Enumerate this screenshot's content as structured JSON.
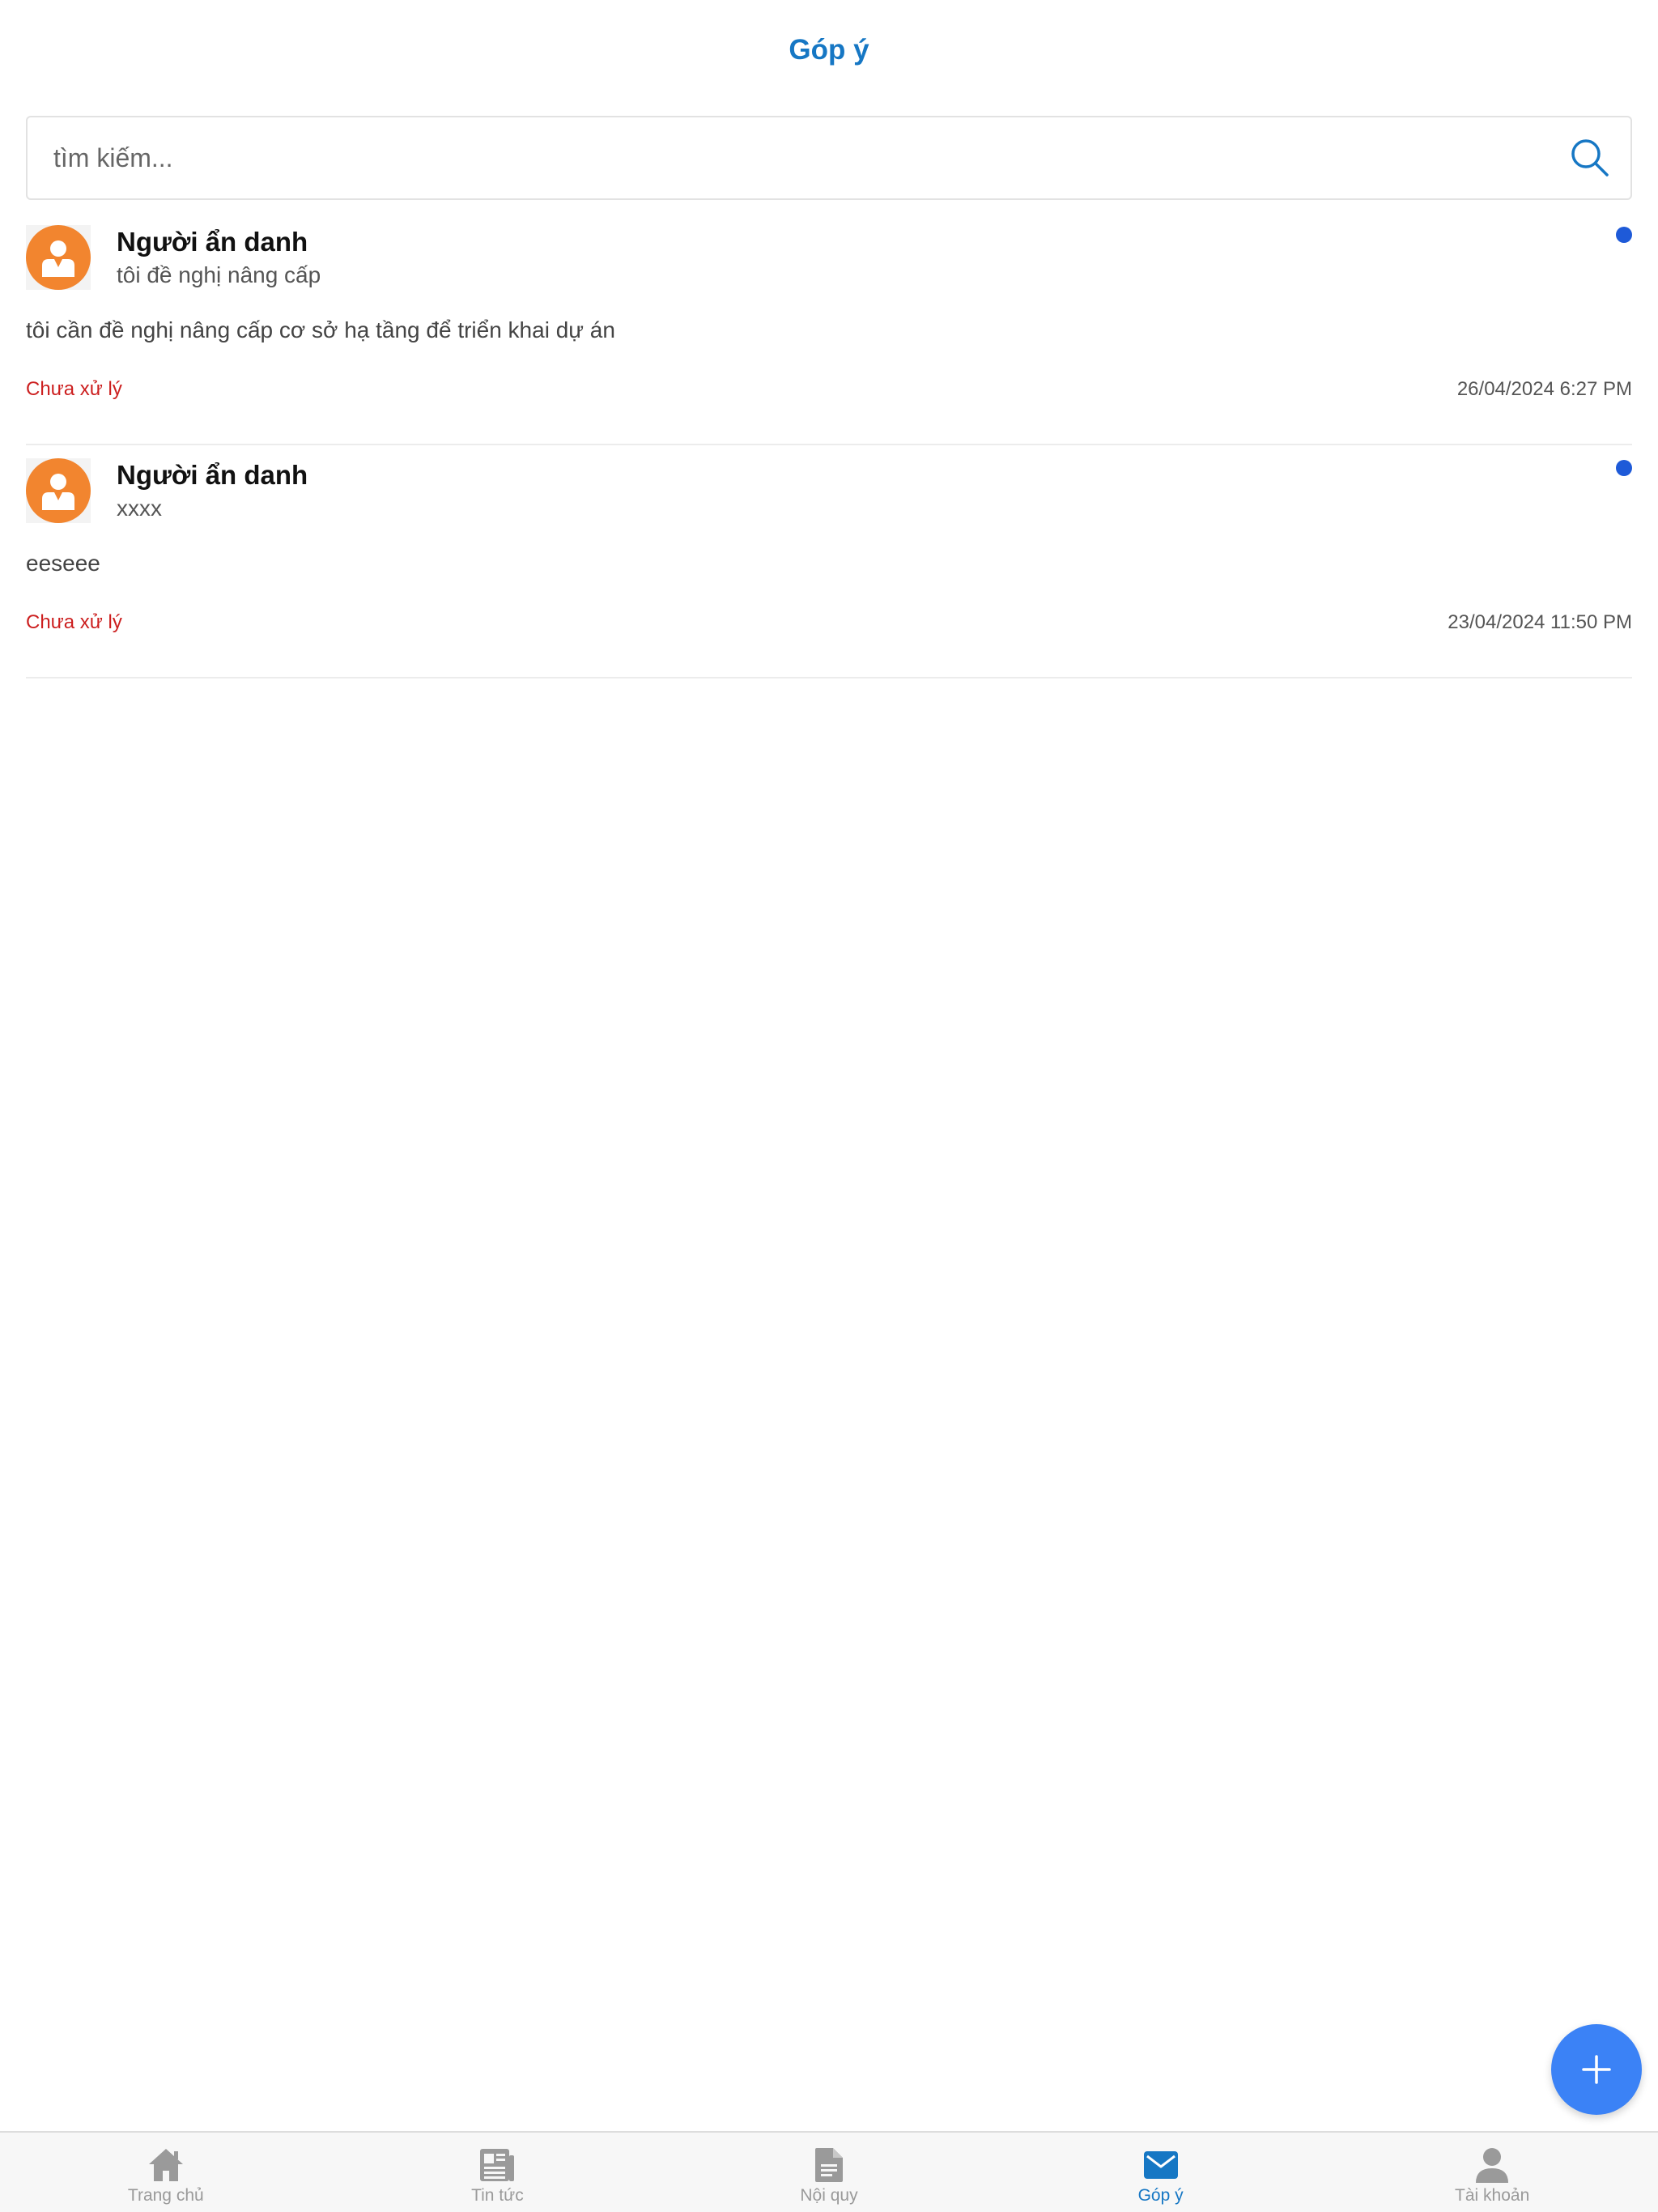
{
  "header": {
    "title": "Góp ý"
  },
  "search": {
    "placeholder": "tìm kiếm..."
  },
  "feedback_items": [
    {
      "name": "Người ẩn danh",
      "subject": "tôi đề nghị nâng cấp",
      "content": "tôi cần đề nghị nâng cấp cơ sở hạ tầng để triển khai dự án",
      "status": "Chưa xử lý",
      "date": "26/04/2024 6:27 PM",
      "icon": "user-avatar-icon"
    },
    {
      "name": "Người ẩn danh",
      "subject": "xxxx",
      "content": "eeseee",
      "status": "Chưa xử lý",
      "date": "23/04/2024 11:50 PM",
      "icon": "user-avatar-icon"
    }
  ],
  "fab": {
    "icon": "plus-icon"
  },
  "tabbar": {
    "tabs": [
      {
        "label": "Trang chủ",
        "icon": "home-icon",
        "active": false
      },
      {
        "label": "Tin tức",
        "icon": "newspaper-icon",
        "active": false
      },
      {
        "label": "Nội quy",
        "icon": "document-icon",
        "active": false
      },
      {
        "label": "Góp ý",
        "icon": "mail-icon",
        "active": true
      },
      {
        "label": "Tài khoản",
        "icon": "account-icon",
        "active": false
      }
    ]
  },
  "colors": {
    "accent": "#1677c4",
    "status_pending": "#cc1f1f",
    "unread_dot": "#1e5ad8",
    "avatar": "#f2852f",
    "fab": "#3b82f6",
    "tab_inactive": "#9a9a9a"
  }
}
